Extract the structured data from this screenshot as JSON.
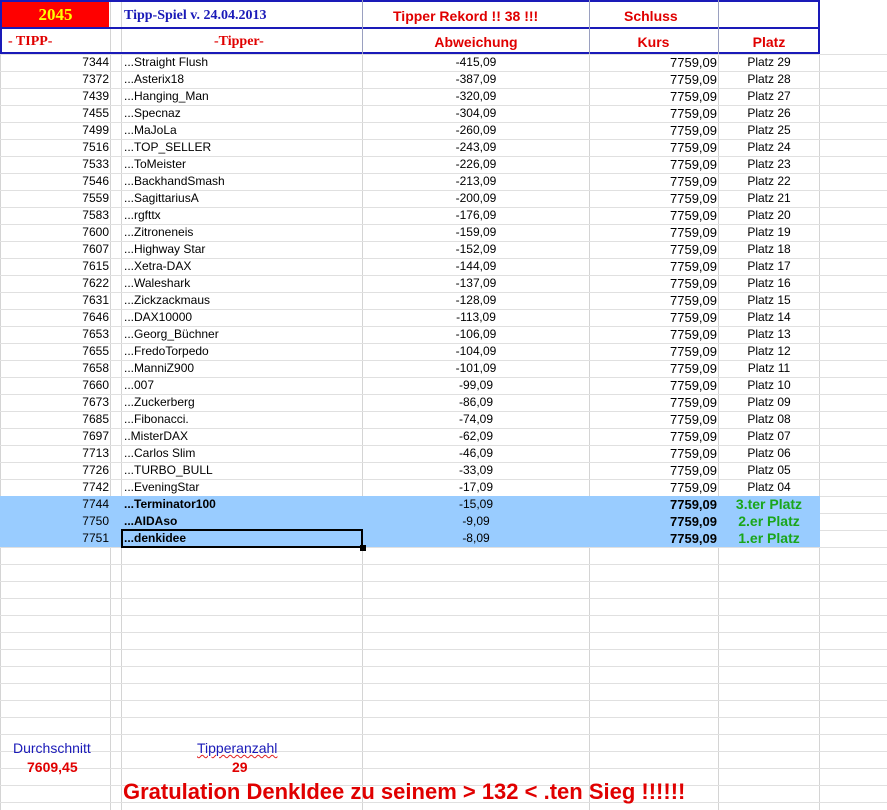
{
  "header": {
    "tipp_value": "2045",
    "title": "Tipp-Spiel v. 24.04.2013",
    "rekord": "Tipper Rekord !!  38  !!!",
    "schluss": "Schluss",
    "col_tipp": "- TIPP-",
    "col_tipper": "-Tipper-",
    "col_abweichung": "Abweichung",
    "col_kurs": "Kurs",
    "col_platz": "Platz"
  },
  "rows": [
    {
      "tipp": "7344",
      "name": "...Straight Flush",
      "abw": "-415,09",
      "kurs": "7759,09",
      "platz": "Platz 29"
    },
    {
      "tipp": "7372",
      "name": "...Asterix18",
      "abw": "-387,09",
      "kurs": "7759,09",
      "platz": "Platz 28"
    },
    {
      "tipp": "7439",
      "name": "...Hanging_Man",
      "abw": "-320,09",
      "kurs": "7759,09",
      "platz": "Platz 27"
    },
    {
      "tipp": "7455",
      "name": "...Specnaz",
      "abw": "-304,09",
      "kurs": "7759,09",
      "platz": "Platz 26"
    },
    {
      "tipp": "7499",
      "name": "...MaJoLa",
      "abw": "-260,09",
      "kurs": "7759,09",
      "platz": "Platz 25"
    },
    {
      "tipp": "7516",
      "name": "...TOP_SELLER",
      "abw": "-243,09",
      "kurs": "7759,09",
      "platz": "Platz 24"
    },
    {
      "tipp": "7533",
      "name": "...ToMeister",
      "abw": "-226,09",
      "kurs": "7759,09",
      "platz": "Platz 23"
    },
    {
      "tipp": "7546",
      "name": "...BackhandSmash",
      "abw": "-213,09",
      "kurs": "7759,09",
      "platz": "Platz 22"
    },
    {
      "tipp": "7559",
      "name": "...SagittariusA",
      "abw": "-200,09",
      "kurs": "7759,09",
      "platz": "Platz 21"
    },
    {
      "tipp": "7583",
      "name": "...rgfttx",
      "abw": "-176,09",
      "kurs": "7759,09",
      "platz": "Platz 20"
    },
    {
      "tipp": "7600",
      "name": "...Zitroneneis",
      "abw": "-159,09",
      "kurs": "7759,09",
      "platz": "Platz 19"
    },
    {
      "tipp": "7607",
      "name": "...Highway Star",
      "abw": "-152,09",
      "kurs": "7759,09",
      "platz": "Platz 18"
    },
    {
      "tipp": "7615",
      "name": "...Xetra-DAX",
      "abw": "-144,09",
      "kurs": "7759,09",
      "platz": "Platz 17"
    },
    {
      "tipp": "7622",
      "name": "...Waleshark",
      "abw": "-137,09",
      "kurs": "7759,09",
      "platz": "Platz 16"
    },
    {
      "tipp": "7631",
      "name": "...Zickzackmaus",
      "abw": "-128,09",
      "kurs": "7759,09",
      "platz": "Platz 15"
    },
    {
      "tipp": "7646",
      "name": "...DAX10000",
      "abw": "-113,09",
      "kurs": "7759,09",
      "platz": "Platz 14"
    },
    {
      "tipp": "7653",
      "name": "...Georg_Büchner",
      "abw": "-106,09",
      "kurs": "7759,09",
      "platz": "Platz 13"
    },
    {
      "tipp": "7655",
      "name": "...FredoTorpedo",
      "abw": "-104,09",
      "kurs": "7759,09",
      "platz": "Platz 12"
    },
    {
      "tipp": "7658",
      "name": "...ManniZ900",
      "abw": "-101,09",
      "kurs": "7759,09",
      "platz": "Platz 11"
    },
    {
      "tipp": "7660",
      "name": "...007",
      "abw": "-99,09",
      "kurs": "7759,09",
      "platz": "Platz 10"
    },
    {
      "tipp": "7673",
      "name": "...Zuckerberg",
      "abw": "-86,09",
      "kurs": "7759,09",
      "platz": "Platz 09"
    },
    {
      "tipp": "7685",
      "name": "...Fibonacci.",
      "abw": "-74,09",
      "kurs": "7759,09",
      "platz": "Platz 08"
    },
    {
      "tipp": "7697",
      "name": "..MisterDAX",
      "abw": "-62,09",
      "kurs": "7759,09",
      "platz": "Platz 07"
    },
    {
      "tipp": "7713",
      "name": "...Carlos Slim",
      "abw": "-46,09",
      "kurs": "7759,09",
      "platz": "Platz 06"
    },
    {
      "tipp": "7726",
      "name": "...TURBO_BULL",
      "abw": "-33,09",
      "kurs": "7759,09",
      "platz": "Platz 05"
    },
    {
      "tipp": "7742",
      "name": "...EveningStar",
      "abw": "-17,09",
      "kurs": "7759,09",
      "platz": "Platz 04"
    },
    {
      "tipp": "7744",
      "name": "...Terminator100",
      "abw": "-15,09",
      "kurs": "7759,09",
      "platz": "3.ter Platz",
      "highlight": true
    },
    {
      "tipp": "7750",
      "name": "...AIDAso",
      "abw": "-9,09",
      "kurs": "7759,09",
      "platz": "2.er Platz",
      "highlight": true
    },
    {
      "tipp": "7751",
      "name": "...denkidee",
      "abw": "-8,09",
      "kurs": "7759,09",
      "platz": "1.er Platz",
      "highlight": true
    }
  ],
  "footer": {
    "durchschnitt_label": "Durchschnitt",
    "durchschnitt_value": "7609,45",
    "tipperanzahl_label": "Tipperanzahl",
    "tipperanzahl_value": "29",
    "gratulation": "Gratulation DenkIdee  zu seinem > 132 < .ten Sieg !!!!!!"
  },
  "colors": {
    "header_border": "#1a1ab8",
    "tipp_box_bg": "#ff0000",
    "tipp_box_text": "#ffff00",
    "title_blue": "#1a1ab8",
    "red_text": "#e00000",
    "highlight_row": "#99ccff",
    "winner_green": "#1aa61a"
  }
}
